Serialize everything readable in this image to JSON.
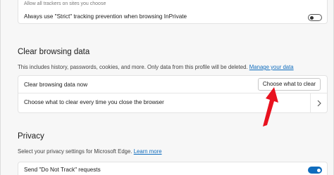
{
  "top_card": {
    "faint_text": "Allow all trackers on sites you choose",
    "strict_label": "Always use \"Strict\" tracking prevention when browsing InPrivate",
    "strict_toggle_on": false
  },
  "clear_section": {
    "title": "Clear browsing data",
    "description": "This includes history, passwords, cookies, and more. Only data from this profile will be deleted.",
    "link": "Manage your data",
    "now_label": "Clear browsing data now",
    "button_label": "Choose what to clear",
    "every_time_label": "Choose what to clear every time you close the browser"
  },
  "privacy_section": {
    "title": "Privacy",
    "description": "Select your privacy settings for Microsoft Edge.",
    "link": "Learn more",
    "dnt_label": "Send \"Do Not Track\" requests",
    "dnt_toggle_on": true
  },
  "colors": {
    "accent": "#0f6cbd",
    "annotation_arrow": "#e8121f"
  },
  "icons": {
    "chevron": "chevron-right-icon",
    "annotation": "red-arrow-annotation"
  }
}
